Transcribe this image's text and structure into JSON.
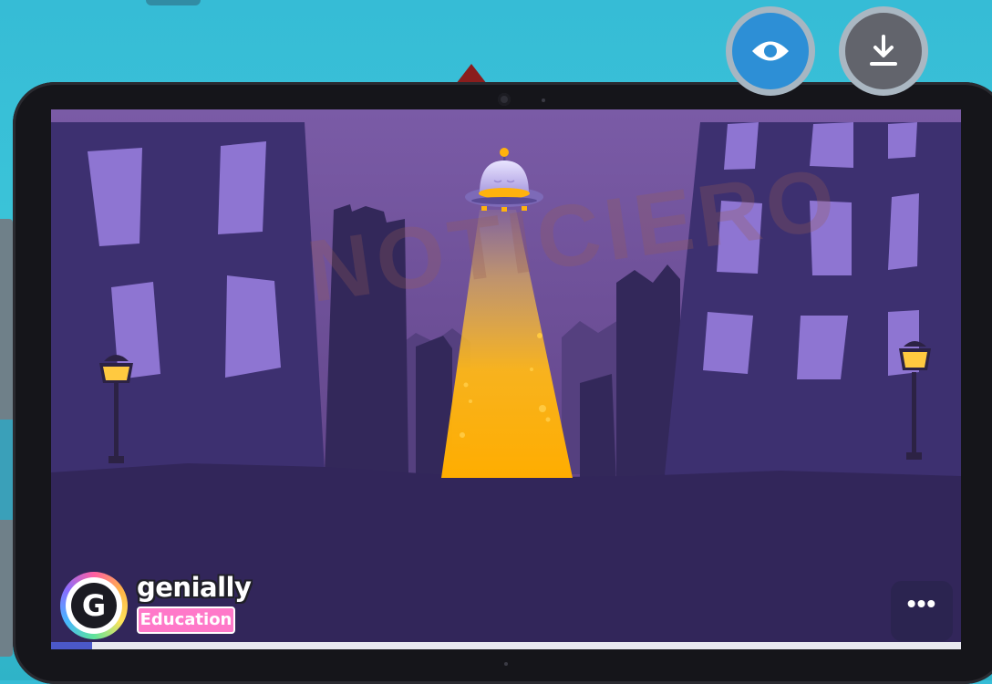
{
  "controls": {
    "view_button": {
      "icon": "eye-icon",
      "color": "#2d8fd6"
    },
    "download_button": {
      "icon": "download-icon",
      "color": "#62646c"
    }
  },
  "presentation": {
    "watermark_text": "NOTICIERO",
    "progress_fraction": 0.045
  },
  "branding": {
    "logo_letter": "G",
    "name": "genially",
    "badge": "Education",
    "badge_color": "#ff79c9"
  },
  "menu": {
    "more_label": "•••",
    "more_icon": "ellipsis-icon"
  },
  "colors": {
    "background": "#3cc6d9",
    "scene_sky": "#76589e",
    "buildings": "#3c2f6c",
    "windows": "#8e75d2",
    "light_beam": "#ffb20e"
  }
}
